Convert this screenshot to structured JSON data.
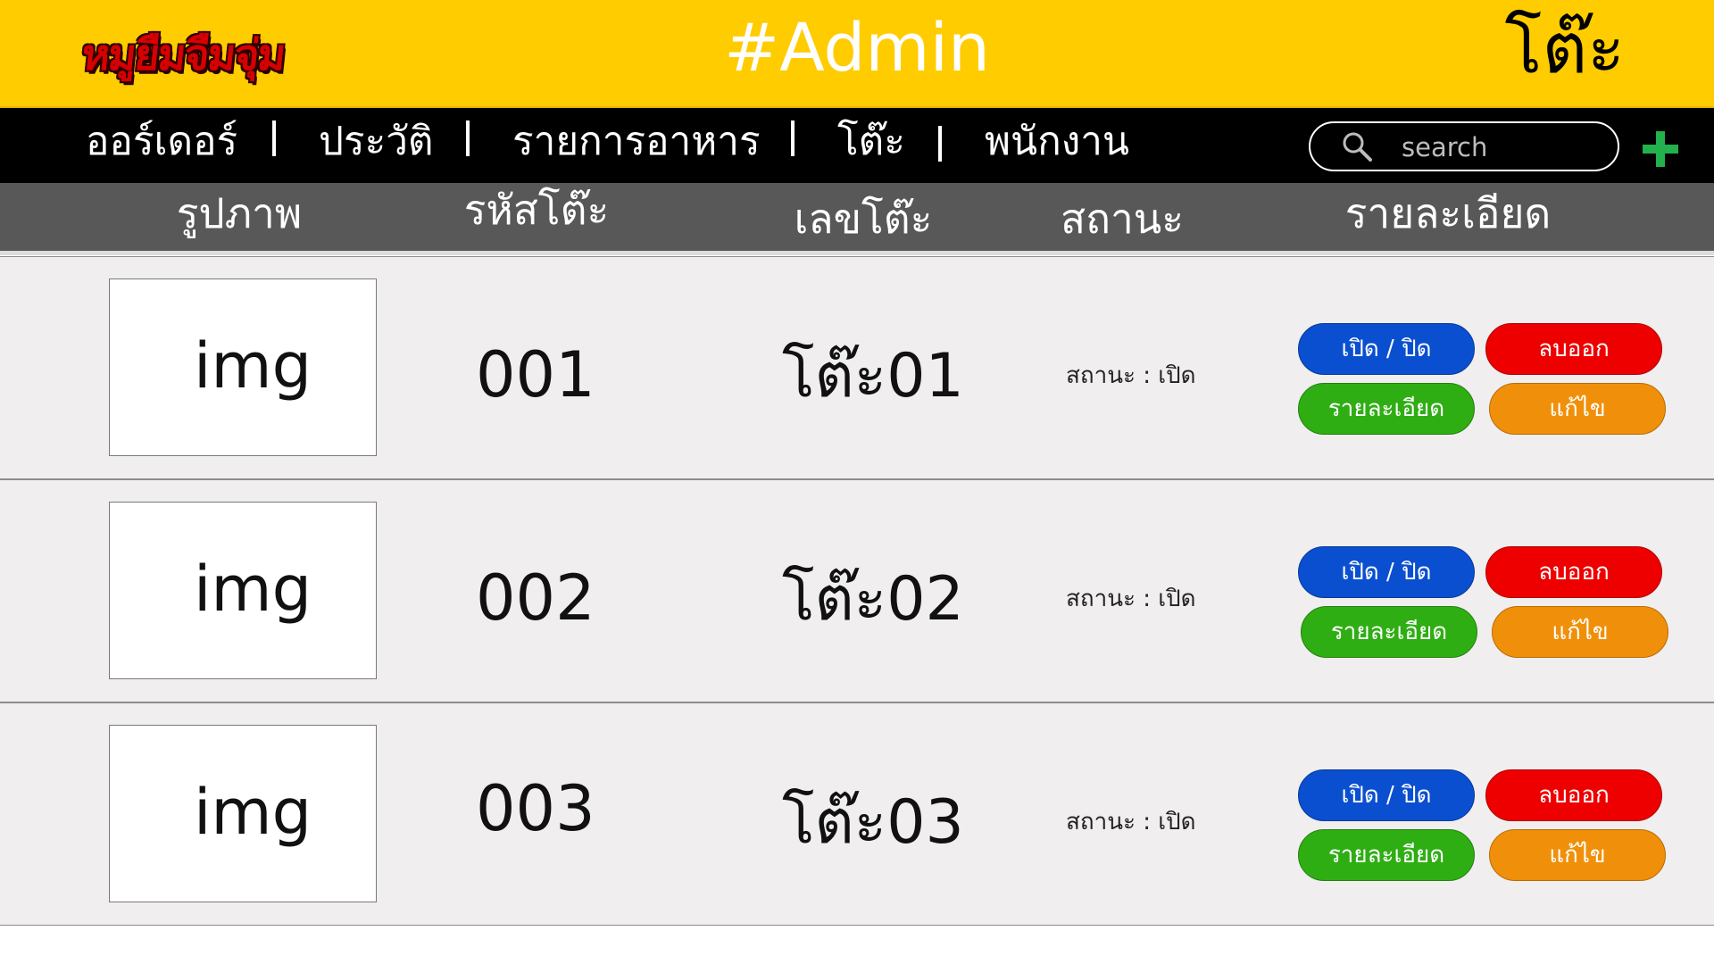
{
  "header": {
    "logo_text": "หมูยืมจืมจุ่ม",
    "title": "#Admin",
    "page_name": "โต๊ะ",
    "colors": {
      "background": "#ffcc00",
      "logo": "#d60000"
    }
  },
  "nav": {
    "items": [
      {
        "label": "ออร์เดอร์"
      },
      {
        "label": "ประวัติ"
      },
      {
        "label": "รายการอาหาร"
      },
      {
        "label": "โต๊ะ"
      },
      {
        "label": "พนักงาน"
      }
    ],
    "search": {
      "placeholder": "search",
      "value": "",
      "icon": "search-icon"
    },
    "add_icon": "plus-icon",
    "add_color": "#22b14c"
  },
  "columns": {
    "image": "รูปภาพ",
    "code": "รหัสโต๊ะ",
    "number": "เลขโต๊ะ",
    "status": "สถานะ",
    "detail": "รายละเอียด"
  },
  "rows": [
    {
      "image_placeholder": "img",
      "code": "001",
      "number": "โต๊ะ01",
      "status": "สถานะ : เปิด",
      "buttons": {
        "toggle": "เปิด / ปิด",
        "delete": "ลบออก",
        "detail": "รายละเอียด",
        "edit": "แก้ไข"
      }
    },
    {
      "image_placeholder": "img",
      "code": "002",
      "number": "โต๊ะ02",
      "status": "สถานะ : เปิด",
      "buttons": {
        "toggle": "เปิด / ปิด",
        "delete": "ลบออก",
        "detail": "รายละเอียด",
        "edit": "แก้ไข"
      }
    },
    {
      "image_placeholder": "img",
      "code": "003",
      "number": "โต๊ะ03",
      "status": "สถานะ : เปิด",
      "buttons": {
        "toggle": "เปิด / ปิด",
        "delete": "ลบออก",
        "detail": "รายละเอียด",
        "edit": "แก้ไข"
      }
    }
  ],
  "button_colors": {
    "toggle": "#0a4fd0",
    "delete": "#ee0000",
    "detail": "#2fae14",
    "edit": "#f0900a"
  }
}
